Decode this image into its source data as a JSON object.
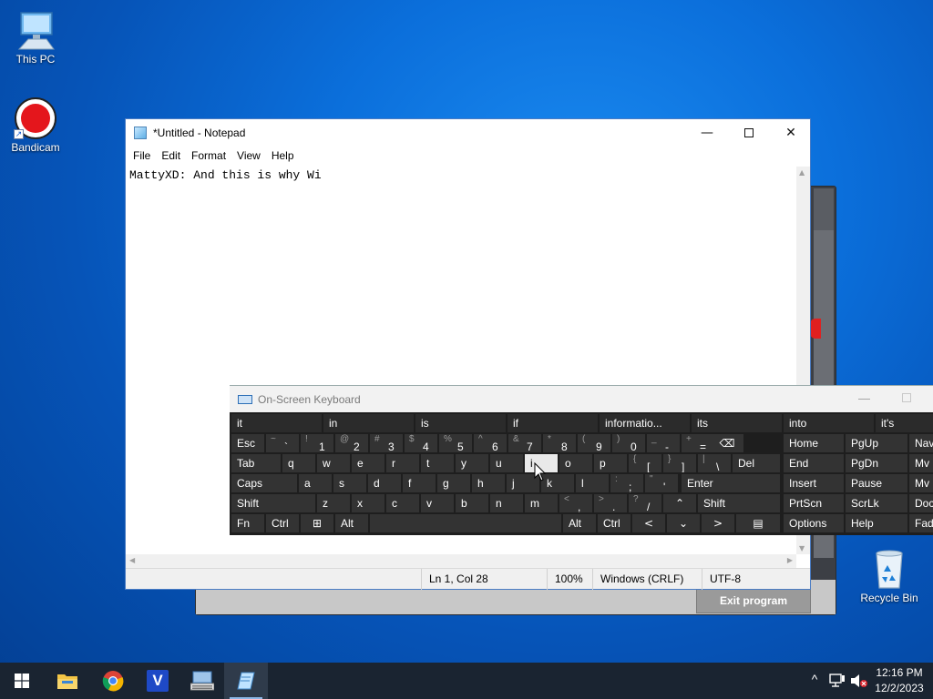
{
  "desktop": {
    "icons": [
      {
        "label": "This PC"
      },
      {
        "label": "Bandicam"
      },
      {
        "label": "Recycle Bin"
      }
    ]
  },
  "background_app": {
    "exit_label": "Exit program"
  },
  "notepad": {
    "title": "*Untitled - Notepad",
    "menu": [
      "File",
      "Edit",
      "Format",
      "View",
      "Help"
    ],
    "content": "MattyXD: And this is why Wi",
    "status": {
      "position": "Ln 1, Col 28",
      "zoom": "100%",
      "line_ending": "Windows (CRLF)",
      "encoding": "UTF-8"
    }
  },
  "osk": {
    "title": "On-Screen Keyboard",
    "suggestions": [
      "it",
      "in",
      "is",
      "if",
      "informatio...",
      "its",
      "into",
      "it's"
    ],
    "row1": {
      "esc": "Esc",
      "keys": [
        {
          "shift": "~",
          "main": "`"
        },
        {
          "shift": "!",
          "main": "1"
        },
        {
          "shift": "@",
          "main": "2"
        },
        {
          "shift": "#",
          "main": "3"
        },
        {
          "shift": "$",
          "main": "4"
        },
        {
          "shift": "%",
          "main": "5"
        },
        {
          "shift": "^",
          "main": "6"
        },
        {
          "shift": "&",
          "main": "7"
        },
        {
          "shift": "*",
          "main": "8"
        },
        {
          "shift": "(",
          "main": "9"
        },
        {
          "shift": ")",
          "main": "0"
        },
        {
          "shift": "_",
          "main": "-"
        },
        {
          "shift": "+",
          "main": "="
        }
      ]
    },
    "row2": {
      "tab": "Tab",
      "letters": [
        "q",
        "w",
        "e",
        "r",
        "t",
        "y",
        "u",
        "i",
        "o",
        "p"
      ],
      "brackets": [
        {
          "shift": "{",
          "main": "["
        },
        {
          "shift": "}",
          "main": "]"
        },
        {
          "shift": "|",
          "main": "\\"
        }
      ],
      "del": "Del"
    },
    "row3": {
      "caps": "Caps",
      "letters": [
        "a",
        "s",
        "d",
        "f",
        "g",
        "h",
        "j",
        "k",
        "l"
      ],
      "punct": [
        {
          "shift": ":",
          "main": ";"
        },
        {
          "shift": "\"",
          "main": "'"
        }
      ],
      "enter": "Enter"
    },
    "row4": {
      "shift_left": "Shift",
      "letters": [
        "z",
        "x",
        "c",
        "v",
        "b",
        "n",
        "m"
      ],
      "punct": [
        {
          "shift": "<",
          "main": ","
        },
        {
          "shift": ">",
          "main": "."
        },
        {
          "shift": "?",
          "main": "/"
        }
      ],
      "shift_right": "Shift"
    },
    "row5": {
      "fn": "Fn",
      "ctrl_left": "Ctrl",
      "alt_left": "Alt",
      "alt_right": "Alt",
      "ctrl_right": "Ctrl"
    },
    "nav": {
      "col1": [
        "Home",
        "End",
        "Insert",
        "PrtScn",
        "Options"
      ],
      "col2": [
        "PgUp",
        "PgDn",
        "Pause",
        "ScrLk",
        "Help"
      ],
      "col3": [
        "Nav",
        "Mv U",
        "Mv D",
        "Dock",
        "Fade"
      ]
    },
    "highlighted_key": "i"
  },
  "taskbar": {
    "clock_time": "12:16 PM",
    "clock_date": "12/2/2023",
    "apps": [
      "start-button",
      "file-explorer",
      "chrome",
      "v-app",
      "virtual-keyboard-app",
      "notepad"
    ]
  },
  "colors": {
    "accent": "#8db7e6",
    "osk_key": "#333333",
    "osk_highlight": "#e9e9e9",
    "taskbar": "#1a2431"
  }
}
